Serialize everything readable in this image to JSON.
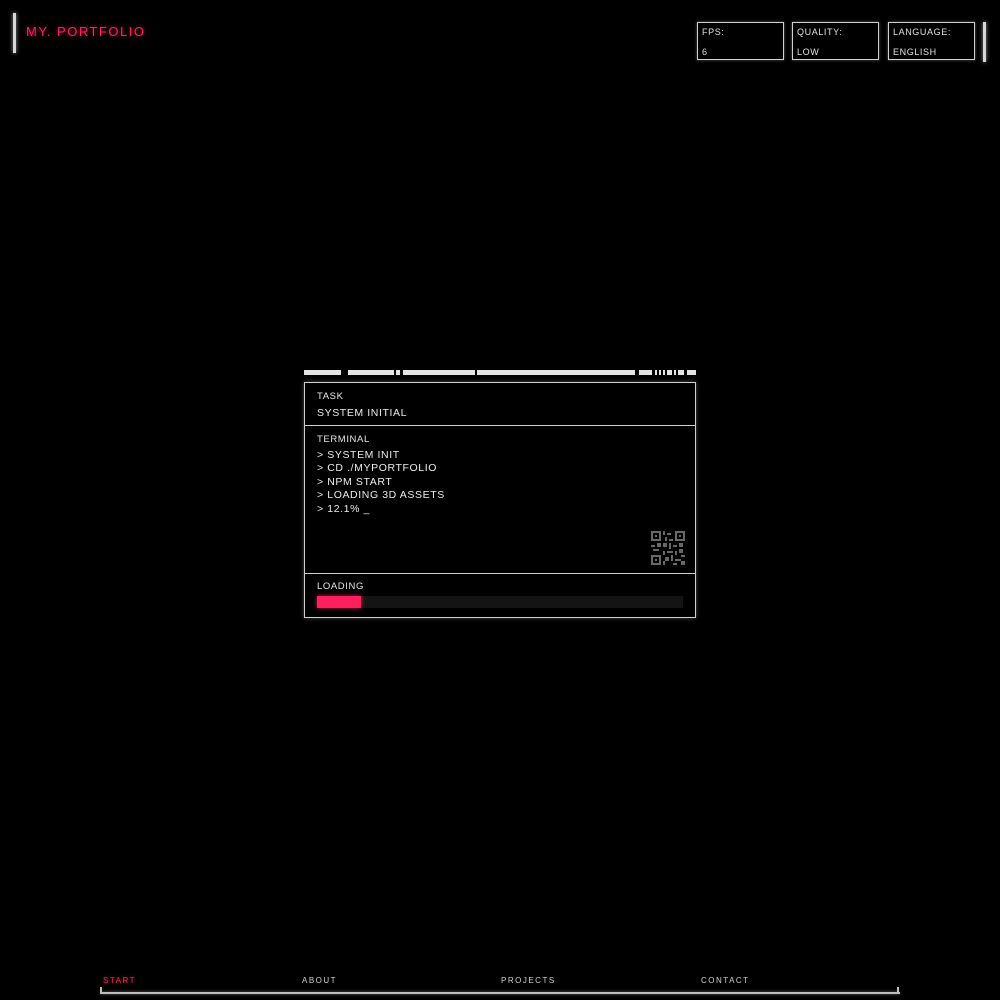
{
  "header": {
    "brand": "MY. PORTFOLIO"
  },
  "settings": {
    "fps": {
      "label": "FPS:",
      "value": "6"
    },
    "quality": {
      "label": "QUALITY:",
      "value": "LOW"
    },
    "language": {
      "label": "LANGUAGE:",
      "value": "ENGLISH"
    }
  },
  "panel": {
    "task": {
      "heading": "TASK",
      "value": "SYSTEM INITIAL"
    },
    "terminal": {
      "heading": "TERMINAL",
      "lines": [
        "> SYSTEM INIT",
        "> CD ./MYPORTFOLIO",
        "> NPM START",
        "> LOADING 3D ASSETS",
        "> 12.1% _"
      ]
    },
    "loading": {
      "heading": "LOADING",
      "progress": 0.121
    }
  },
  "nav": {
    "items": [
      "START",
      "ABOUT",
      "PROJECTS",
      "CONTACT"
    ],
    "active": "START"
  },
  "colors": {
    "accent": "#ff1f5a",
    "foreground": "#e8e8e8",
    "background": "#000000"
  },
  "icons": {
    "qr": "qr-code-icon"
  }
}
